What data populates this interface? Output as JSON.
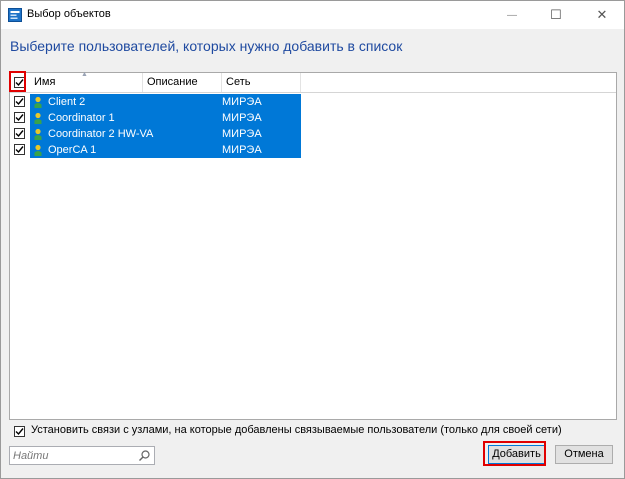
{
  "window": {
    "title": "Выбор объектов",
    "minimize_symbol": "—",
    "maximize_symbol": "☐",
    "close_symbol": "✕"
  },
  "heading": "Выберите пользователей, которых нужно добавить в список",
  "table": {
    "columns": {
      "name": "Имя",
      "description": "Описание",
      "network": "Сеть"
    },
    "select_all_checked": true,
    "rows": [
      {
        "name": "Client 2",
        "description": "",
        "network": "МИРЭА Учебна...",
        "checked": true,
        "selected": true
      },
      {
        "name": "Coordinator 1",
        "description": "",
        "network": "МИРЭА Учебна...",
        "checked": true,
        "selected": true
      },
      {
        "name": "Coordinator 2 HW-VA",
        "description": "",
        "network": "МИРЭА Учебна...",
        "checked": true,
        "selected": true
      },
      {
        "name": "OperCA 1",
        "description": "",
        "network": "МИРЭА Учебна...",
        "checked": true,
        "selected": true
      }
    ]
  },
  "link_option": {
    "label": "Установить связи с узлами, на которые добавлены связываемые пользователи (только для своей сети)",
    "checked": true
  },
  "search": {
    "placeholder": "Найти",
    "value": ""
  },
  "buttons": {
    "add": "Добавить",
    "cancel": "Отмена"
  },
  "icons": {
    "app": "window-app-icon",
    "user": "user-icon",
    "search": "search-icon",
    "check": "checkmark-icon"
  },
  "colors": {
    "selection": "#0078d7",
    "heading": "#1f4aa0",
    "highlight_frame": "#e00000",
    "user_icon_head": "#e8c82a",
    "user_icon_body": "#3aa34a"
  }
}
